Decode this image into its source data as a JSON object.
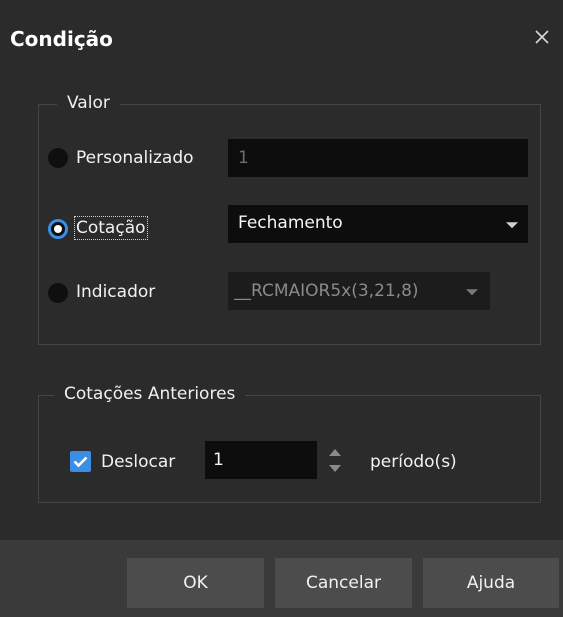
{
  "dialog": {
    "title": "Condição",
    "close_icon": "close-icon"
  },
  "valor": {
    "group_label": "Valor",
    "options": {
      "personalizado": {
        "label": "Personalizado",
        "selected": false,
        "value": "1"
      },
      "cotacao": {
        "label": "Cotação",
        "selected": true,
        "value": "Fechamento"
      },
      "indicador": {
        "label": "Indicador",
        "selected": false,
        "value": "__RCMAIOR5x(3,21,8)"
      }
    }
  },
  "cotacoes_anteriores": {
    "group_label": "Cotações Anteriores",
    "deslocar": {
      "label": "Deslocar",
      "checked": true,
      "value": "1"
    },
    "periodo_label": "período(s)"
  },
  "footer": {
    "ok_label": "OK",
    "cancelar_label": "Cancelar",
    "ajuda_label": "Ajuda"
  },
  "colors": {
    "background": "#2b2b2b",
    "input": "#0d0d0d",
    "accent": "#3a8ee6",
    "footer": "#3a3a3a",
    "button": "#4c4c4c"
  }
}
